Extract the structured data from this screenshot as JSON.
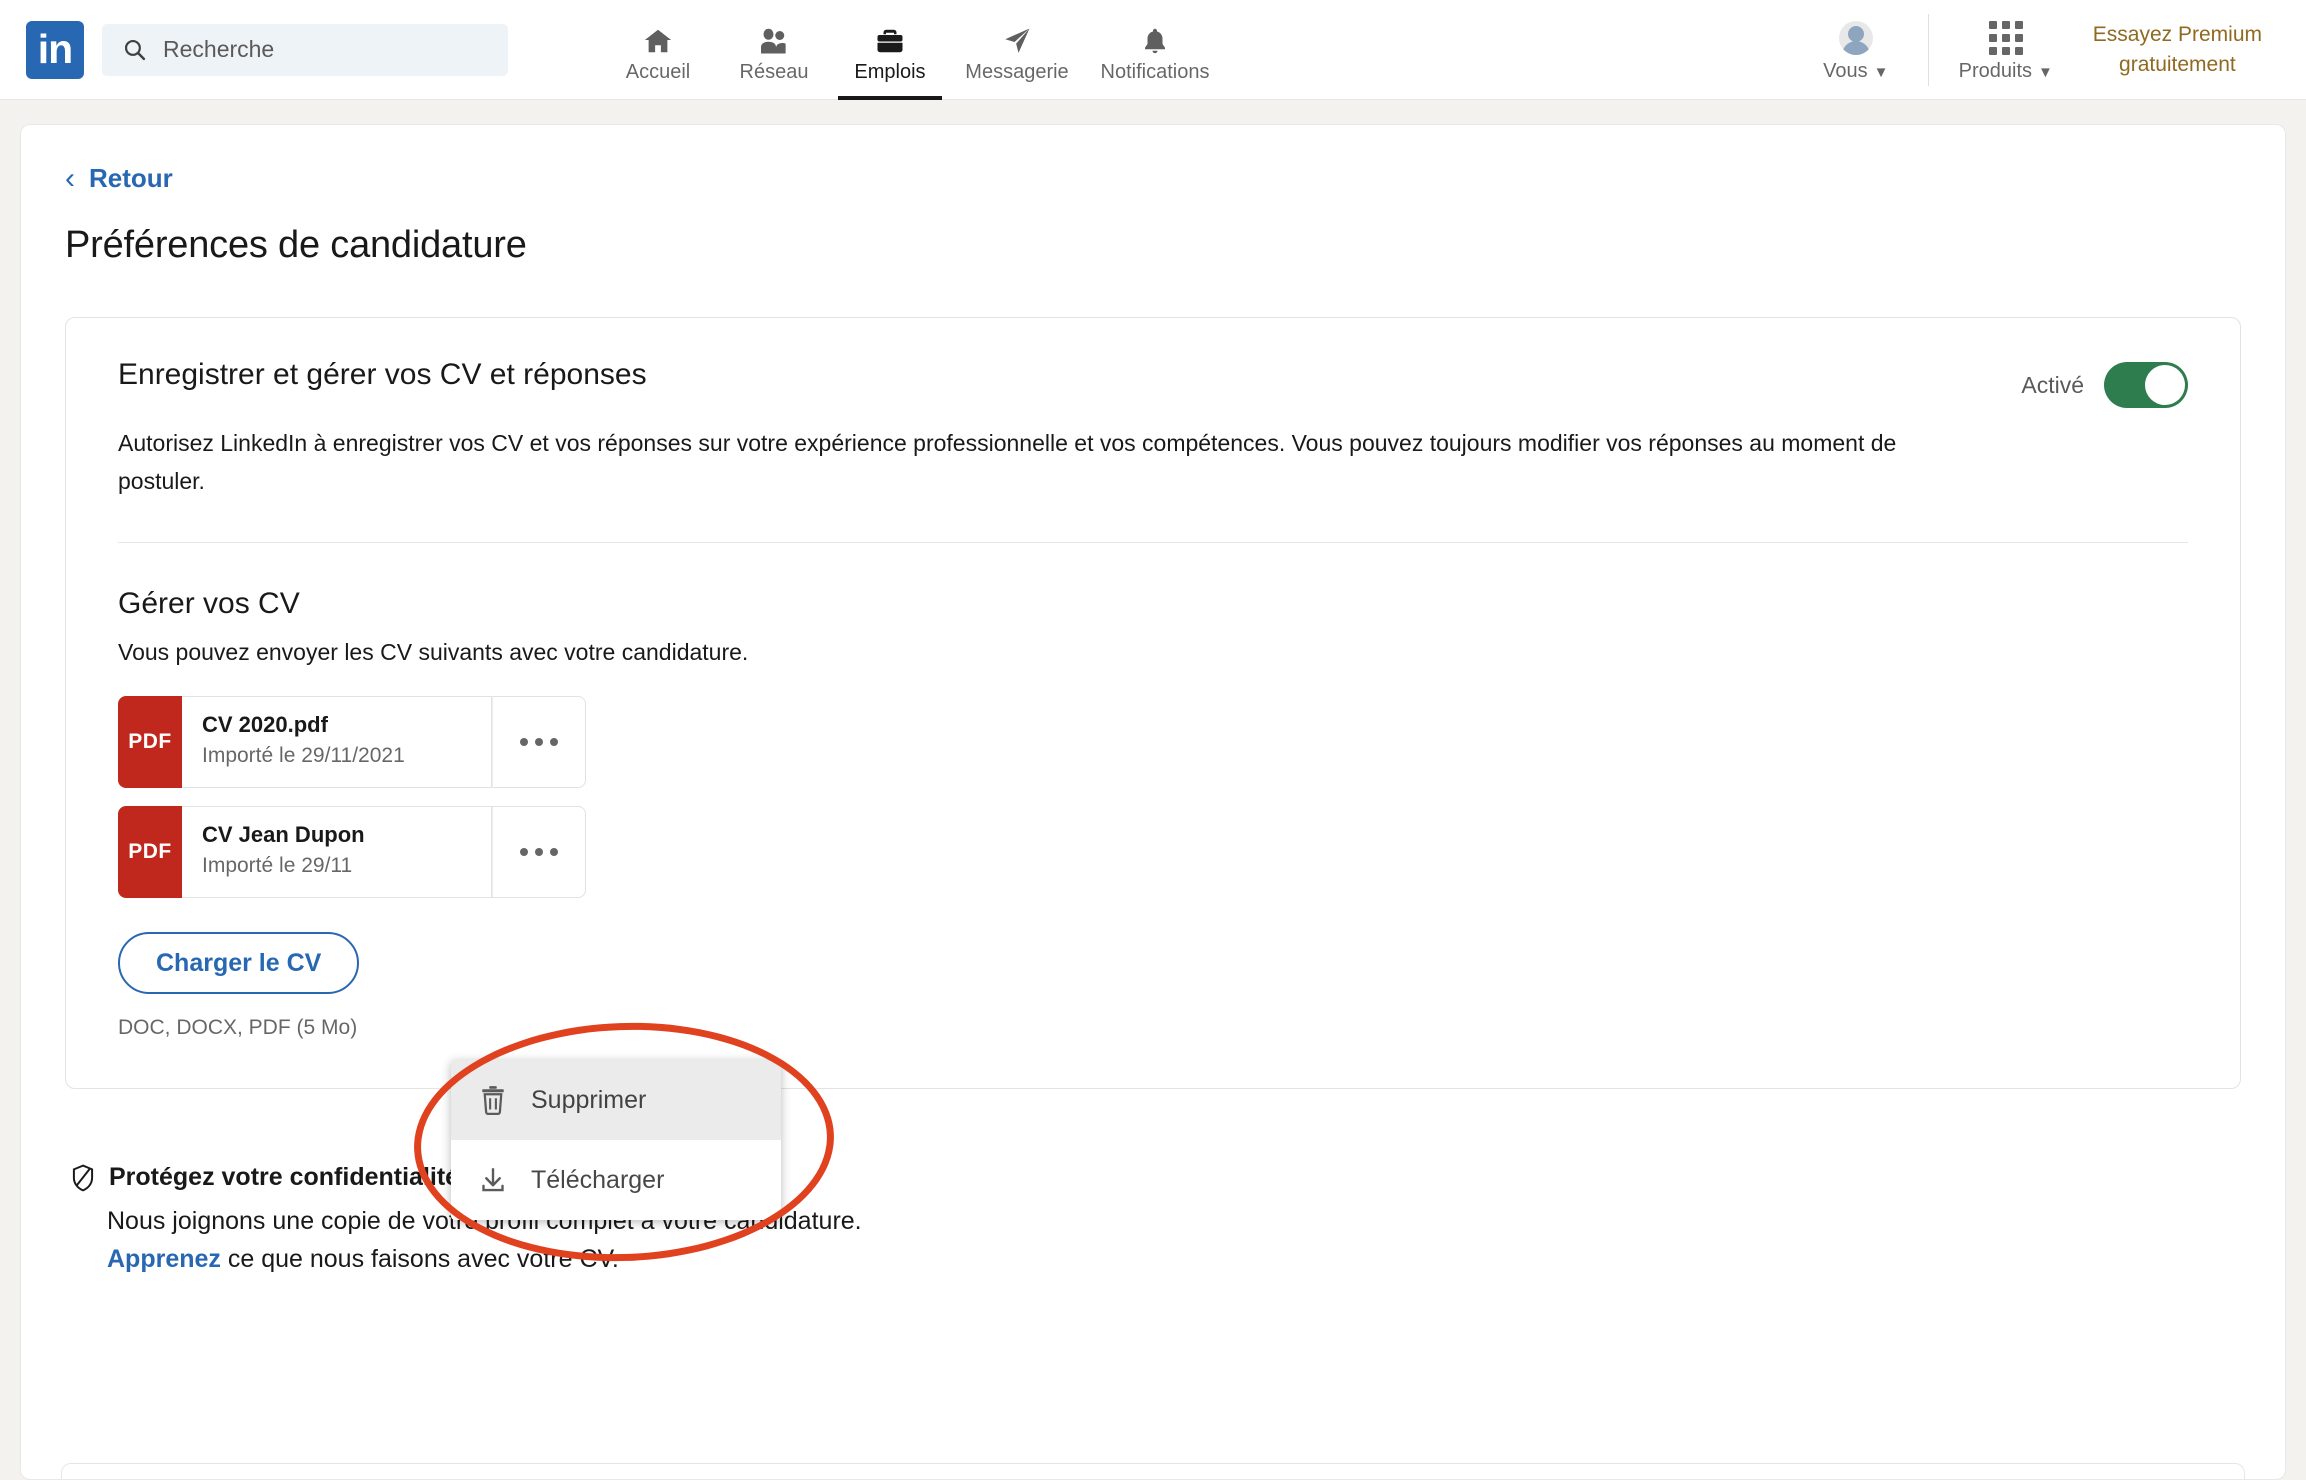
{
  "nav": {
    "logo_text": "in",
    "search": {
      "placeholder": "Recherche",
      "value": "",
      "icon": "search-icon"
    },
    "items": [
      {
        "label": "Accueil",
        "icon": "home-icon",
        "active": false
      },
      {
        "label": "Réseau",
        "icon": "network-icon",
        "active": false
      },
      {
        "label": "Emplois",
        "icon": "briefcase-icon",
        "active": true
      },
      {
        "label": "Messagerie",
        "icon": "send-message-icon",
        "active": false
      },
      {
        "label": "Notifications",
        "icon": "bell-icon",
        "active": false
      }
    ],
    "me": {
      "label": "Vous",
      "icon": "avatar-icon",
      "caret": "▼"
    },
    "products": {
      "label": "Produits",
      "icon": "grid-apps-icon",
      "caret": "▼"
    },
    "premium": {
      "line1": "Essayez Premium",
      "line2": "gratuitement",
      "color": "#8f6a20"
    }
  },
  "page": {
    "back_label": "Retour",
    "back_chevron": "‹",
    "title": "Préférences de candidature"
  },
  "save_section": {
    "title": "Enregistrer et gérer vos CV et réponses",
    "description": "Autorisez LinkedIn à enregistrer vos CV et vos réponses sur votre expérience professionnelle et vos compétences. Vous pouvez toujours modifier vos réponses au moment de postuler.",
    "toggle_label": "Activé",
    "toggle_on": true,
    "toggle_color": "#2e7d4f"
  },
  "manage_section": {
    "title": "Gérer vos CV",
    "description": "Vous pouvez envoyer les CV suivants avec votre candidature.",
    "files": [
      {
        "badge": "PDF",
        "name": "CV 2020.pdf",
        "date": "Importé le 29/11/2021",
        "menu_icon": "ellipsis-icon"
      },
      {
        "badge": "PDF",
        "name": "CV Jean Dupon",
        "date": "Importé le 29/11",
        "menu_icon": "ellipsis-icon"
      }
    ],
    "upload_button": "Charger le CV",
    "upload_hint": "DOC, DOCX, PDF (5 Mo)"
  },
  "dropdown": {
    "items": [
      {
        "label": "Supprimer",
        "icon": "trash-icon",
        "hovered": true
      },
      {
        "label": "Télécharger",
        "icon": "download-icon",
        "hovered": false
      }
    ]
  },
  "privacy": {
    "icon": "shield-icon",
    "title": "Protégez votre confidentialité",
    "line1": "Nous joignons une copie de votre profil complet à votre candidature.",
    "link": "Apprenez",
    "line2_rest": " ce que nous faisons avec votre CV."
  },
  "annotation": {
    "shape": "ellipse",
    "color": "#e0411f"
  }
}
